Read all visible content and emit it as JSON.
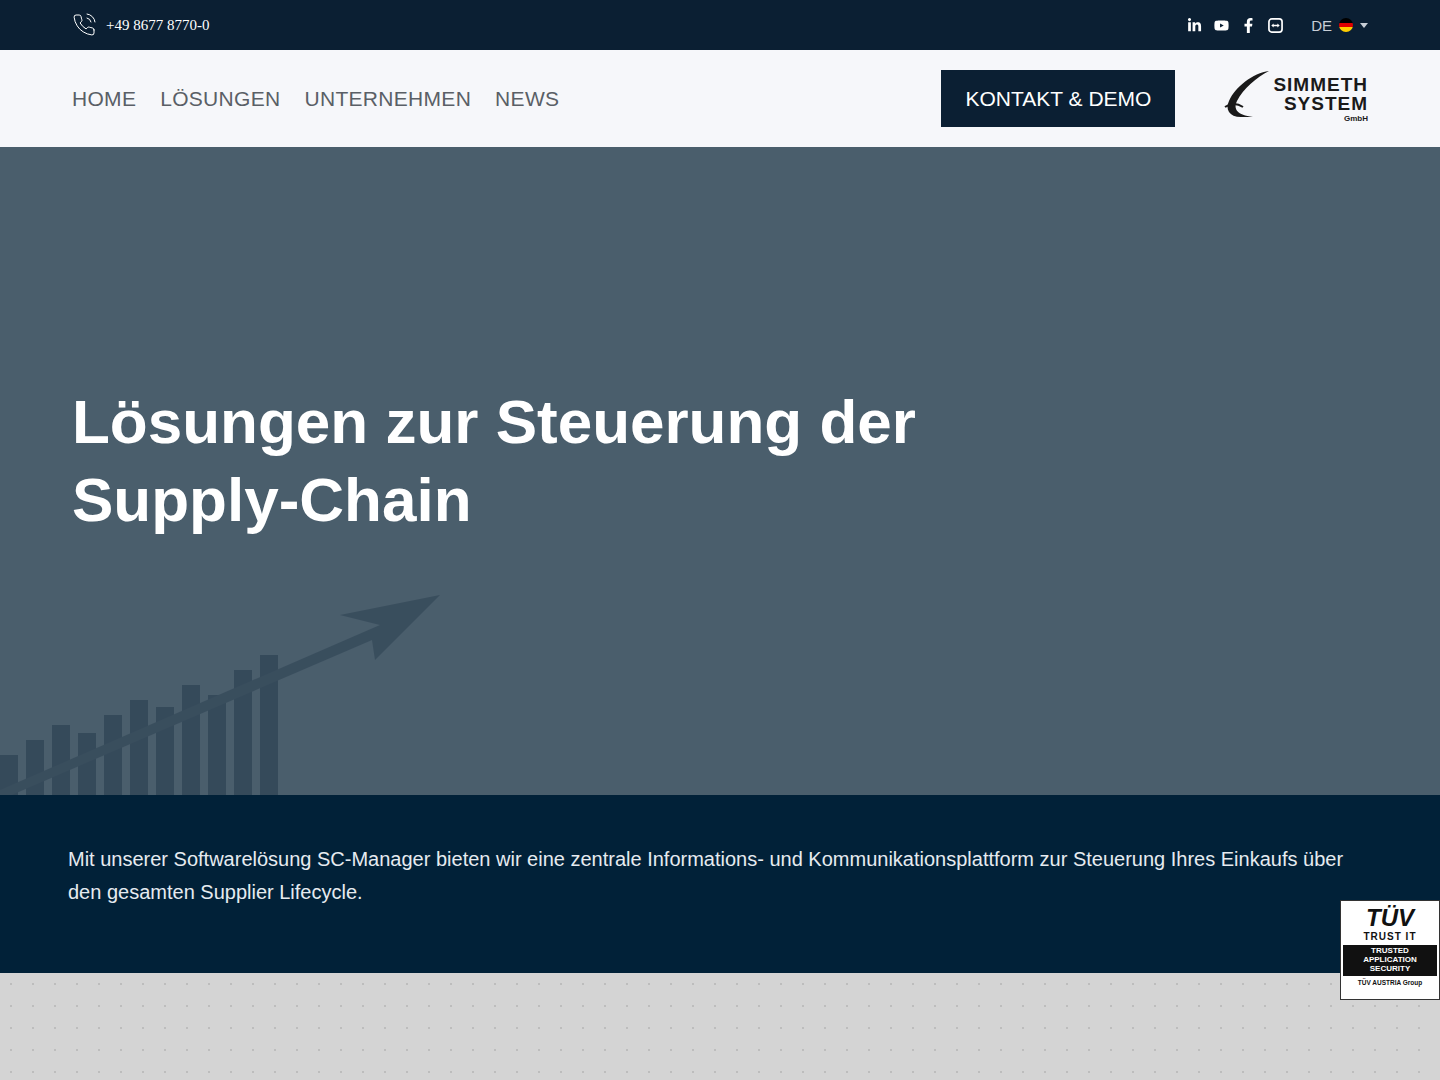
{
  "top_bar": {
    "phone": "+49 8677 8770-0",
    "language": {
      "label": "DE"
    }
  },
  "nav": {
    "items": [
      {
        "label": "HOME",
        "selected": false
      },
      {
        "label": "LÖSUNGEN",
        "selected": false
      },
      {
        "label": "UNTERNEHMEN",
        "selected": false
      },
      {
        "label": "NEWS",
        "selected": false
      }
    ],
    "cta": "KONTAKT & DEMO",
    "logo": {
      "line1": "SIMMETH",
      "line2": "SYSTEM",
      "suffix": "GmbH"
    }
  },
  "hero": {
    "title_lines": [
      "Lösungen zur Steuerung der",
      "Supply-Chain"
    ]
  },
  "intro": {
    "text": "Mit unserer Softwarelösung SC-Manager bieten wir eine zentrale Informations- und Kommunikationsplattform zur Steuerung Ihres Einkaufs über den gesamten Supplier Lifecycle."
  },
  "badge": {
    "brand": "TÜV",
    "claim": "TRUST IT",
    "seal": "TRUSTED APPLICATION SECURITY",
    "group": "TÜV AUSTRIA Group"
  }
}
